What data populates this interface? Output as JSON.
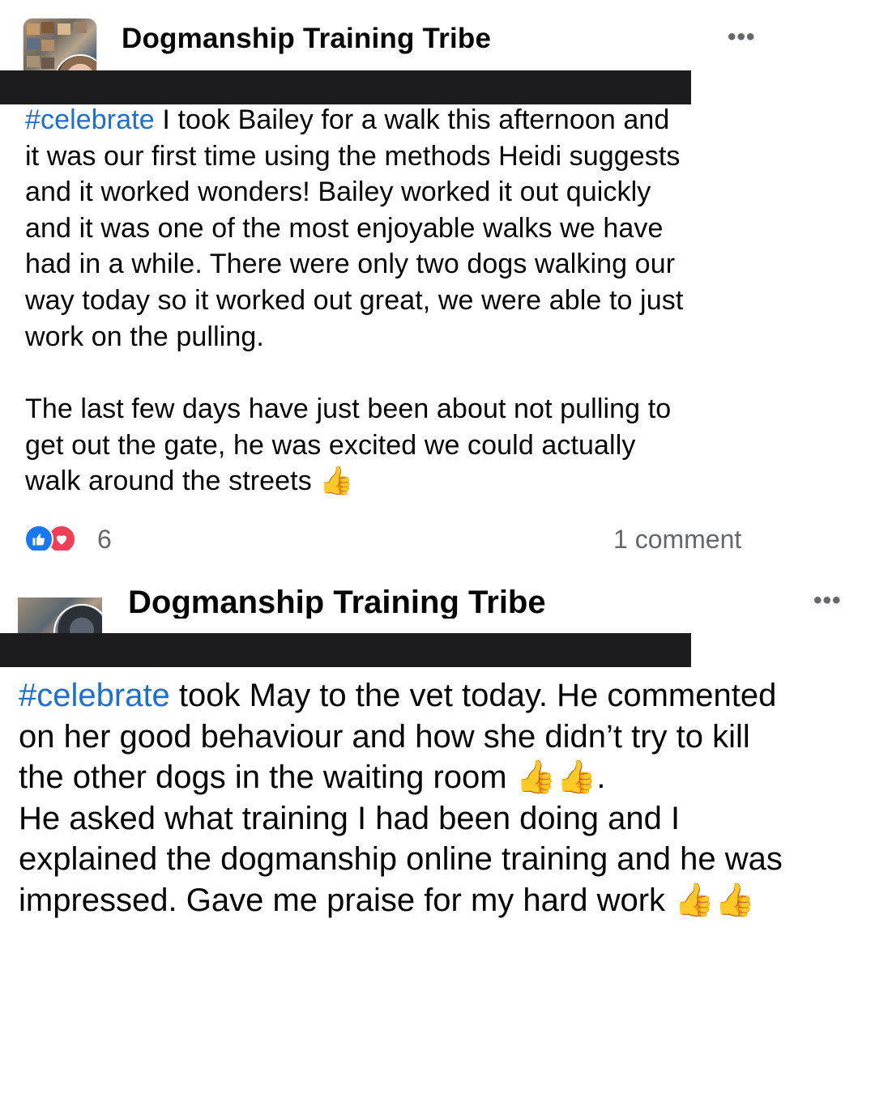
{
  "posts": [
    {
      "group_name": "Dogmanship Training Tribe",
      "more_icon": "•••",
      "hashtag": "#celebrate",
      "para1_lines": [
        " I took Bailey for a walk this afternoon and",
        "it was our first time using the methods Heidi suggests",
        "and it worked wonders! Bailey worked it out quickly",
        "and it was one of the most enjoyable walks we have",
        "had in a while. There were only two dogs walking our",
        "way today so it worked out great, we were able to just",
        "work on the pulling."
      ],
      "para2_lines": [
        "The last few days have just been about not pulling to",
        "get out the gate, he was excited we could actually",
        "walk around the streets "
      ],
      "para2_emoji": "👍",
      "reaction_icons": [
        "like-icon",
        "love-icon"
      ],
      "reaction_count": "6",
      "comment_count": "1 comment"
    },
    {
      "group_name": "Dogmanship Training Tribe",
      "more_icon": "•••",
      "hashtag": "#celebrate",
      "line1_rest": " took May to the vet today. He commented",
      "line2": "on her good behaviour and how she didn’t try to kill",
      "line3": "the other dogs in the waiting room ",
      "line3_emoji": "👍👍",
      "line3_tail": ".",
      "line4": "He asked what training I had been doing and I",
      "line5": "explained the dogmanship online training and he was",
      "line6": "impressed. Gave me praise for my hard work ",
      "line6_emoji": "👍👍"
    }
  ],
  "colors": {
    "hashtag": "#1b6fd4",
    "like": "#1877f2",
    "love": "#f33e58",
    "redaction": "#1c1c1e",
    "secondary_text": "#65676b"
  }
}
